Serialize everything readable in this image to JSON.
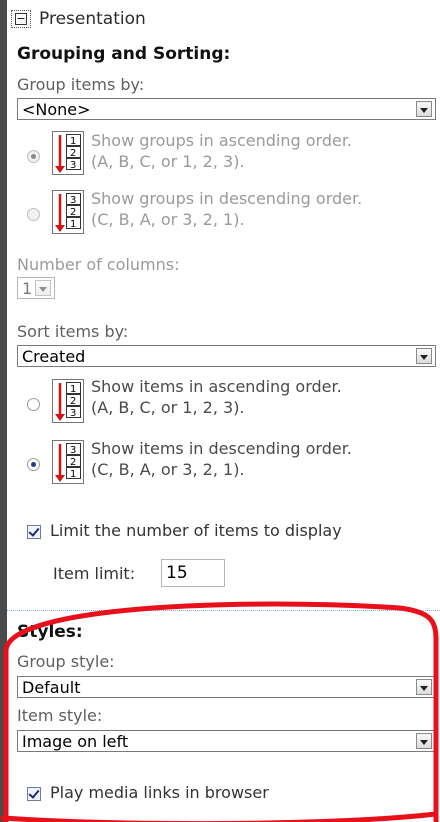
{
  "presentation": {
    "title": "Presentation",
    "collapse_symbol": "−",
    "grouping": {
      "heading": "Grouping and Sorting:",
      "group_by_label": "Group items by:",
      "group_by_value": "<None>",
      "asc_line1": "Show groups in ascending order.",
      "asc_line2": "(A, B, C, or 1, 2, 3).",
      "desc_line1": "Show groups in descending order.",
      "desc_line2": "(C, B, A, or 3, 2, 1).",
      "columns_label": "Number of columns:",
      "columns_value": "1"
    },
    "sorting": {
      "sort_by_label": "Sort items by:",
      "sort_by_value": "Created",
      "asc_line1": "Show items in ascending order.",
      "asc_line2": "(A, B, C, or 1, 2, 3).",
      "desc_line1": "Show items in descending order.",
      "desc_line2": "(C, B, A, or 3, 2, 1).",
      "limit_label": "Limit the number of items to display",
      "item_limit_label": "Item limit:",
      "item_limit_value": "15"
    },
    "styles": {
      "heading": "Styles:",
      "group_style_label": "Group style:",
      "group_style_value": "Default",
      "item_style_label": "Item style:",
      "item_style_value": "Image on left",
      "media_label": "Play media links in browser"
    }
  },
  "icons": {
    "asc_digits": [
      "1",
      "2",
      "3"
    ],
    "desc_digits": [
      "3",
      "2",
      "1"
    ]
  },
  "colors": {
    "highlight_red": "#e8101a",
    "arrow_red": "#d21414",
    "page_bg": "#4a4a4a"
  }
}
